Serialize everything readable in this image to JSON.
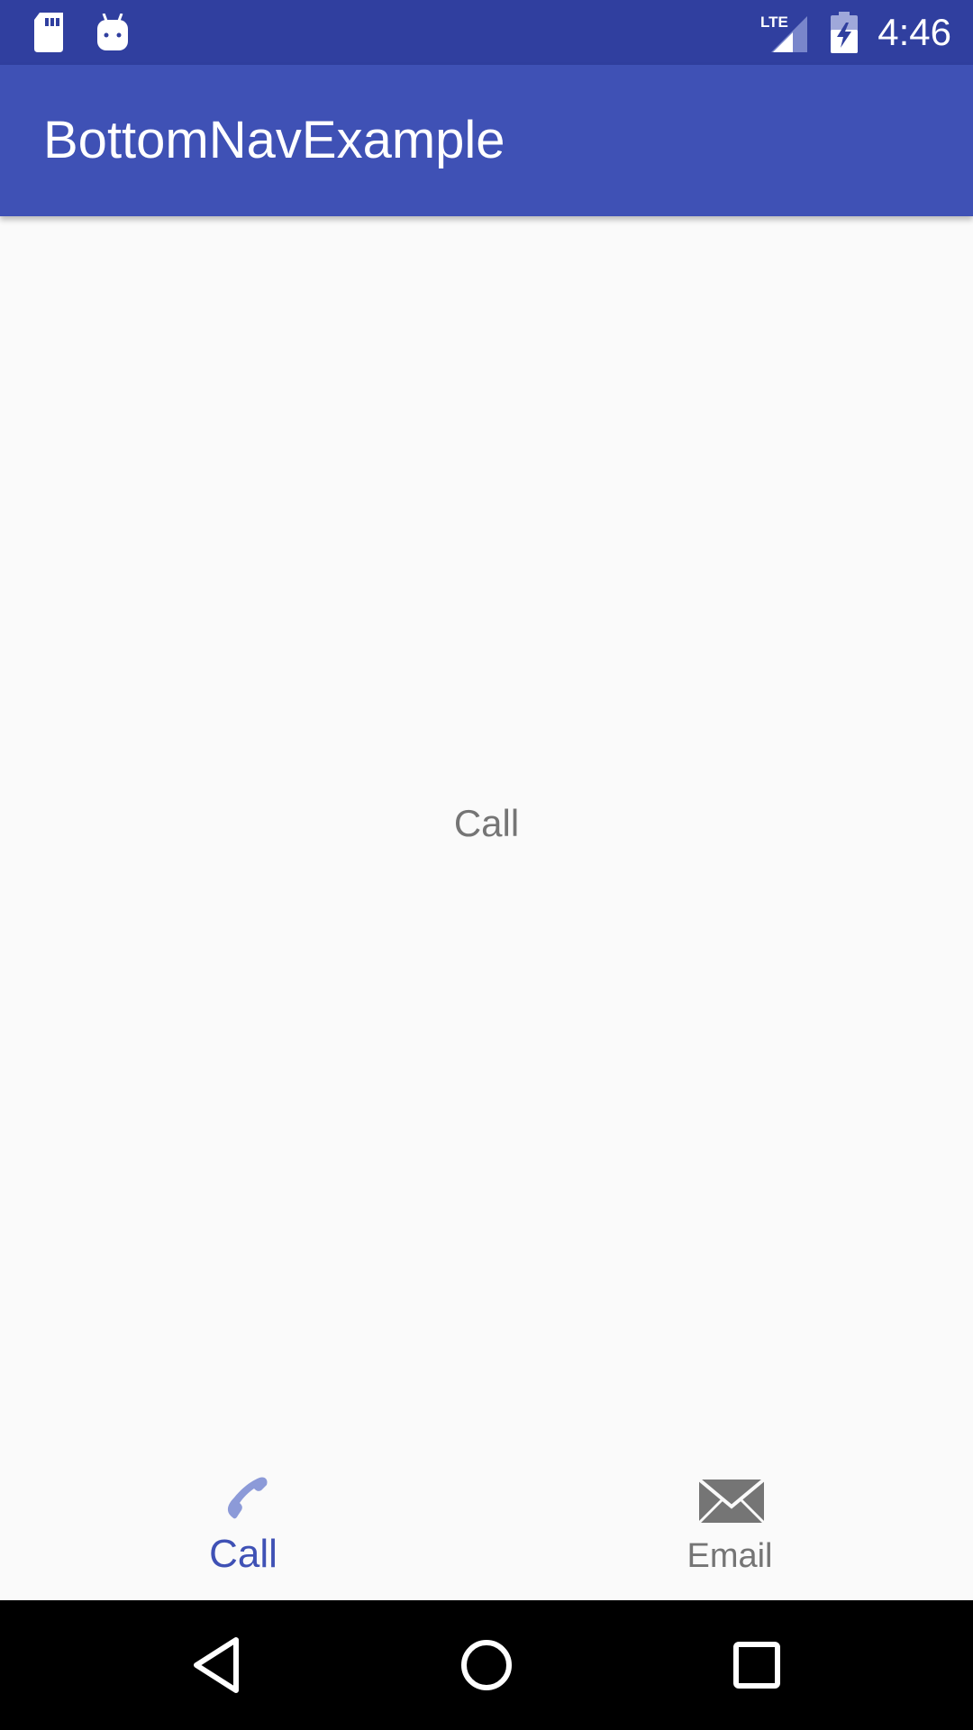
{
  "status_bar": {
    "time": "4:46",
    "network": "LTE",
    "icons": [
      "sd-card-icon",
      "android-debug-icon",
      "lte-signal-icon",
      "battery-charging-icon"
    ],
    "background": "#303f9f"
  },
  "app_bar": {
    "title": "BottomNavExample",
    "background": "#3f51b5"
  },
  "content": {
    "label": "Call"
  },
  "bottom_nav": {
    "items": [
      {
        "label": "Call",
        "icon": "phone-icon",
        "active": true
      },
      {
        "label": "Email",
        "icon": "email-icon",
        "active": false
      }
    ],
    "active_color": "#3f51b5",
    "inactive_color": "#757575"
  },
  "system_nav": {
    "buttons": [
      "back-icon",
      "home-icon",
      "recents-icon"
    ]
  }
}
